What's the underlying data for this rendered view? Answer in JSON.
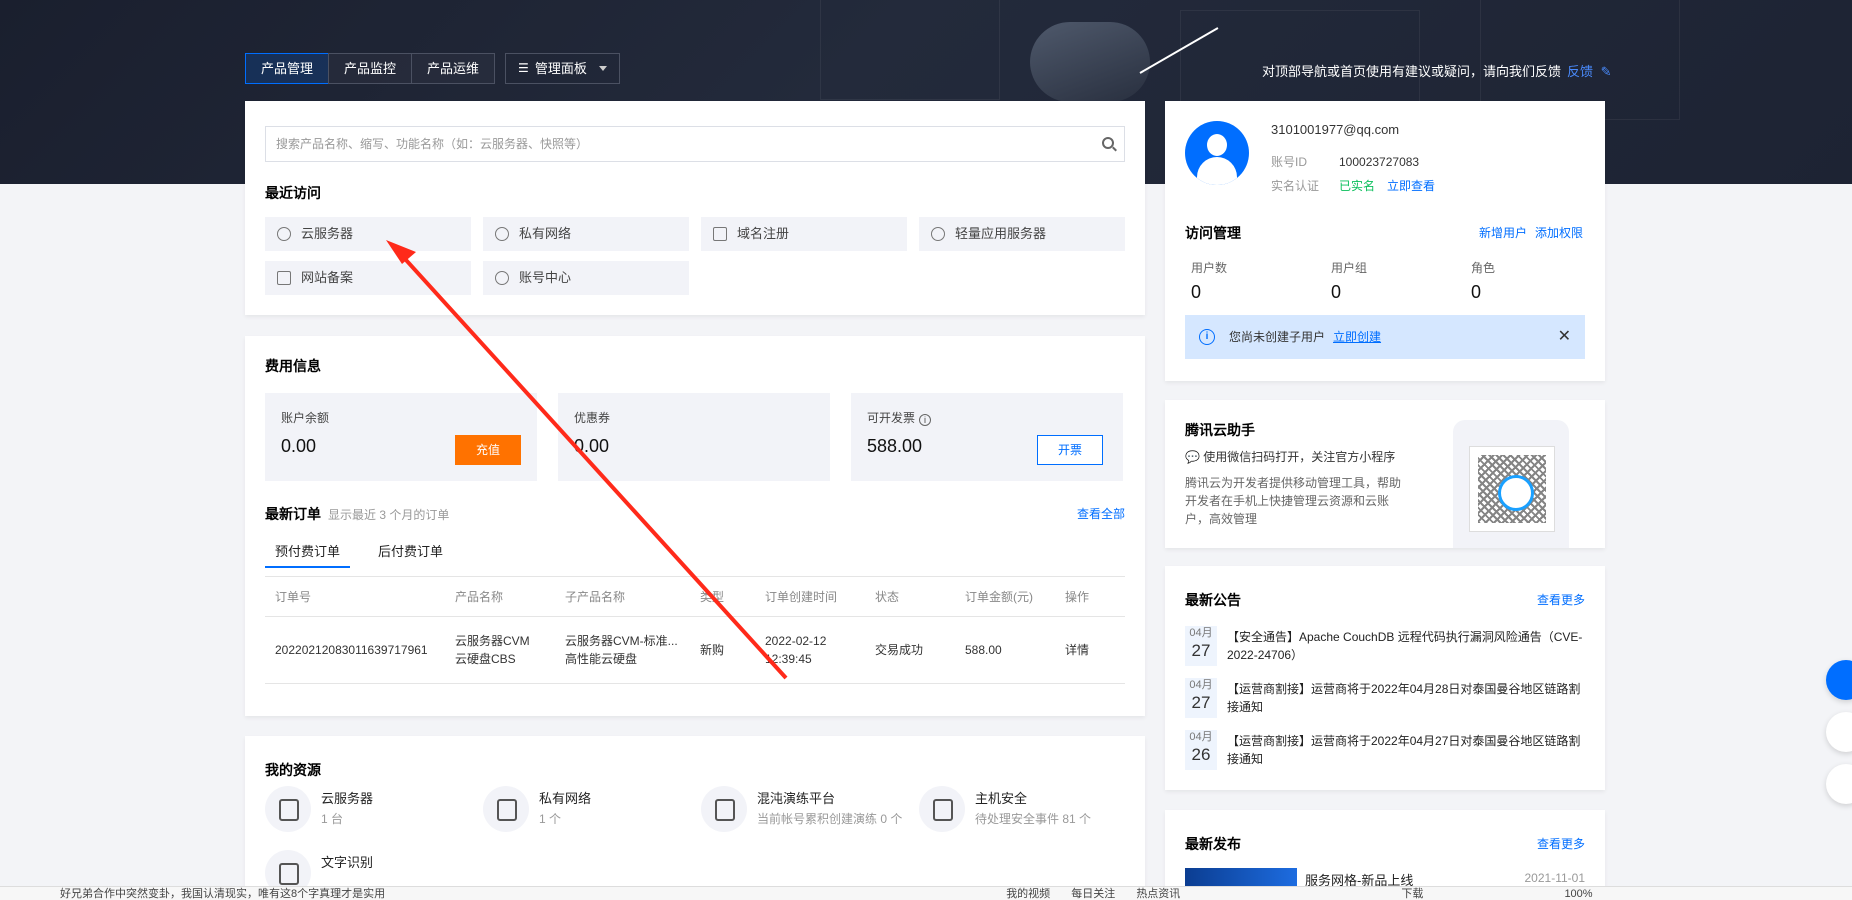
{
  "nav": {
    "tabs": [
      "产品管理",
      "产品监控",
      "产品运维"
    ],
    "panel_button": "管理面板",
    "feedback_text": "对顶部导航或首页使用有建议或疑问，请向我们反馈",
    "feedback_link": "反馈"
  },
  "search": {
    "placeholder": "搜索产品名称、缩写、功能名称（如：云服务器、快照等）"
  },
  "recent": {
    "title": "最近访问",
    "items": [
      "云服务器",
      "私有网络",
      "域名注册",
      "轻量应用服务器",
      "网站备案",
      "账号中心"
    ]
  },
  "fees": {
    "title": "费用信息",
    "balance_label": "账户余额",
    "balance_value": "0.00",
    "recharge_button": "充值",
    "coupon_label": "优惠券",
    "coupon_value": "0.00",
    "invoice_label": "可开发票",
    "invoice_value": "588.00",
    "invoice_button": "开票"
  },
  "orders": {
    "title": "最新订单",
    "subtitle": "显示最近 3 个月的订单",
    "view_all": "查看全部",
    "tabs": [
      "预付费订单",
      "后付费订单"
    ],
    "columns": [
      "订单号",
      "产品名称",
      "子产品名称",
      "类型",
      "订单创建时间",
      "状态",
      "订单金额(元)",
      "操作"
    ],
    "rows": [
      {
        "id": "20220212083011639717961",
        "product_1": "云服务器CVM",
        "product_2": "云硬盘CBS",
        "sub_1": "云服务器CVM-标准...",
        "sub_2": "高性能云硬盘",
        "type": "新购",
        "time_1": "2022-02-12",
        "time_2": "12:39:45",
        "status": "交易成功",
        "amount": "588.00",
        "action": "详情"
      }
    ]
  },
  "resources": {
    "title": "我的资源",
    "items": [
      {
        "name": "云服务器",
        "count": "1 台"
      },
      {
        "name": "私有网络",
        "count": "1 个"
      },
      {
        "name": "混沌演练平台",
        "count": "当前帐号累积创建演练 0 个"
      },
      {
        "name": "主机安全",
        "count": "待处理安全事件 81 个"
      },
      {
        "name": "文字识别",
        "count": ""
      }
    ]
  },
  "account": {
    "email": "3101001977@qq.com",
    "id_label": "账号ID",
    "id_value": "100023727083",
    "verify_label": "实名认证",
    "verify_status": "已实名",
    "verify_link": "立即查看",
    "access_title": "访问管理",
    "add_user": "新增用户",
    "add_perm": "添加权限",
    "stats": [
      {
        "label": "用户数",
        "value": "0"
      },
      {
        "label": "用户组",
        "value": "0"
      },
      {
        "label": "角色",
        "value": "0"
      }
    ],
    "notice_text": "您尚未创建子用户",
    "notice_link": "立即创建"
  },
  "helper": {
    "title": "腾讯云助手",
    "line1": "使用微信扫码打开，关注官方小程序",
    "desc": "腾讯云为开发者提供移动管理工具，帮助开发者在手机上快捷管理云资源和云账户，高效管理"
  },
  "announcements": {
    "title": "最新公告",
    "more": "查看更多",
    "items": [
      {
        "month": "04月",
        "day": "27",
        "text": "【安全通告】Apache CouchDB 远程代码执行漏洞风险通告（CVE-2022-24706）"
      },
      {
        "month": "04月",
        "day": "27",
        "text": "【运营商割接】运营商将于2022年04月28日对泰国曼谷地区链路割接通知"
      },
      {
        "month": "04月",
        "day": "26",
        "text": "【运营商割接】运营商将于2022年04月27日对泰国曼谷地区链路割接通知"
      }
    ]
  },
  "releases": {
    "title": "最新发布",
    "more": "查看更多",
    "first_title": "服务网格-新品上线",
    "first_date": "2021-11-01"
  },
  "taskbar": {
    "items": [
      "好兄弟合作中突然变卦，我国认清现实，唯有这8个字真理才是实用",
      "我的视频",
      "每日关注",
      "热点资讯",
      "下载",
      "100%"
    ]
  },
  "colors": {
    "accent": "#006eff",
    "orange": "#ff7200",
    "success": "#0abf5b",
    "annotation_arrow": "#ff2a1a"
  }
}
